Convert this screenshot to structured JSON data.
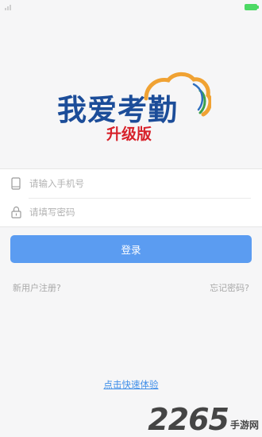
{
  "status_bar": {
    "time": "",
    "battery_color": "#4cd964"
  },
  "logo": {
    "title": "我爱考勤",
    "subtitle": "升级版",
    "title_color": "#1c4d99",
    "subtitle_color": "#d7212a"
  },
  "form": {
    "phone": {
      "value": "",
      "placeholder": "请输入手机号",
      "icon": "phone-icon"
    },
    "password": {
      "value": "",
      "placeholder": "请填写密码",
      "icon": "lock-icon"
    }
  },
  "login_button": {
    "label": "登录",
    "color": "#5b9cf1"
  },
  "links": {
    "register": "新用户注册?",
    "forgot": "忘记密码?",
    "quick_try": "点击快速体验"
  },
  "watermark": {
    "number": "2265",
    "text": "手游网"
  }
}
